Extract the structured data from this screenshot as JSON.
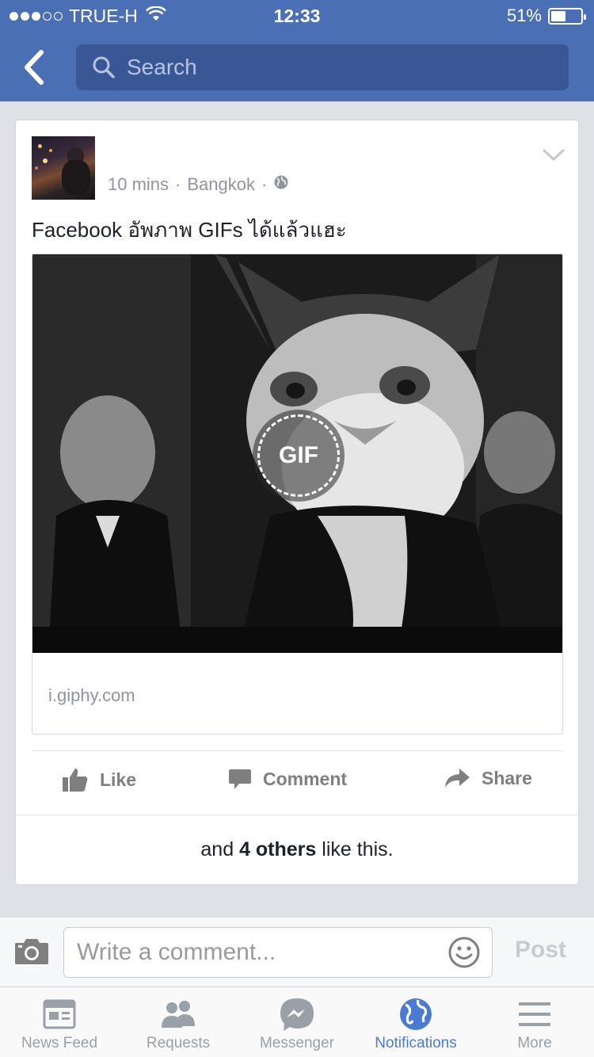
{
  "status_bar": {
    "signal_bars": 3,
    "signal_total": 5,
    "carrier": "TRUE-H",
    "time": "12:33",
    "battery_percent": "51%",
    "battery_level": 0.51
  },
  "nav": {
    "search_placeholder": "Search"
  },
  "post": {
    "time_ago": "10 mins",
    "location": "Bangkok",
    "separator": "·",
    "privacy_icon": "globe-icon",
    "text": "Facebook อัพภาพ GIFs ได้แล้วแฮะ",
    "media_badge": "GIF",
    "link_domain": "i.giphy.com",
    "likes_prefix": "and ",
    "likes_count": "4 others",
    "likes_suffix": " like this."
  },
  "actions": {
    "like": "Like",
    "comment": "Comment",
    "share": "Share"
  },
  "comment_bar": {
    "placeholder": "Write a comment...",
    "post_label": "Post"
  },
  "tabs": [
    {
      "label": "News Feed",
      "icon": "news-feed-icon"
    },
    {
      "label": "Requests",
      "icon": "requests-icon"
    },
    {
      "label": "Messenger",
      "icon": "messenger-icon"
    },
    {
      "label": "Notifications",
      "icon": "globe-icon",
      "active": true
    },
    {
      "label": "More",
      "icon": "menu-icon"
    }
  ],
  "colors": {
    "header_blue": "#4a6fb4",
    "search_bg": "#3a5795",
    "active_tab": "#4a7bd3",
    "muted_text": "#90949c"
  }
}
